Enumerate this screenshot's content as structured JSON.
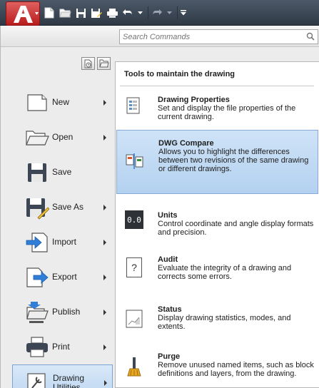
{
  "toolbar": {
    "icons": [
      "new-icon",
      "open-icon",
      "save-icon",
      "save-as-icon",
      "plot-icon",
      "undo-icon",
      "redo-icon",
      "customize-dropdown-icon"
    ],
    "brand_color": "#c41e1e"
  },
  "search": {
    "placeholder": "Search Commands"
  },
  "menu": {
    "items": [
      {
        "label": "New",
        "icon": "new-icon",
        "has_submenu": true
      },
      {
        "label": "Open",
        "icon": "open-folder-icon",
        "has_submenu": true
      },
      {
        "label": "Save",
        "icon": "floppy-icon",
        "has_submenu": false
      },
      {
        "label": "Save As",
        "icon": "save-as-icon",
        "has_submenu": true
      },
      {
        "label": "Import",
        "icon": "import-icon",
        "has_submenu": true
      },
      {
        "label": "Export",
        "icon": "export-icon",
        "has_submenu": true
      },
      {
        "label": "Publish",
        "icon": "publish-icon",
        "has_submenu": true
      },
      {
        "label": "Print",
        "icon": "printer-icon",
        "has_submenu": true
      },
      {
        "label": "Drawing Utilities",
        "icon": "utilities-icon",
        "has_submenu": true,
        "selected": true
      }
    ]
  },
  "submenu": {
    "header": "Tools to maintain the drawing",
    "tools": [
      {
        "title": "Drawing Properties",
        "description": "Set and display the file properties of the current drawing.",
        "icon": "properties-icon"
      },
      {
        "title": "DWG Compare",
        "description": "Allows you to highlight the differences between two revisions of the same drawing or different drawings.",
        "icon": "compare-icon",
        "selected": true
      },
      {
        "title": "Units",
        "description": "Control coordinate and angle display formats and precision.",
        "icon": "units-icon",
        "icon_text": "0.0"
      },
      {
        "title": "Audit",
        "description": "Evaluate the integrity of a drawing and corrects some errors.",
        "icon": "audit-icon",
        "icon_text": "?"
      },
      {
        "title": "Status",
        "description": "Display drawing statistics, modes, and extents.",
        "icon": "status-icon"
      },
      {
        "title": "Purge",
        "description": "Remove unused named items, such as block definitions and layers, from the drawing.",
        "icon": "purge-icon"
      }
    ]
  },
  "colors": {
    "selection_bg": "#bcd6f1",
    "selection_border": "#7da2ce"
  }
}
